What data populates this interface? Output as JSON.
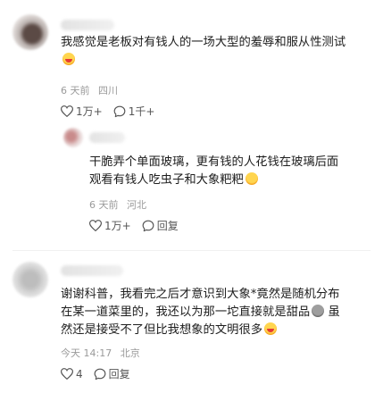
{
  "comments": [
    {
      "text": "我感觉是老板对有钱人的一场大型的羞辱和服从性测试",
      "time": "6 天前",
      "location": "四川",
      "likes": "1万+",
      "replies": "1千+"
    },
    {
      "text_line1": "干脆弄个单面玻璃，更有钱的人花钱在玻璃后面",
      "text_line2": "观看有钱人吃虫子和大象粑粑",
      "time": "6 天前",
      "location": "河北",
      "likes": "1万+",
      "reply_label": "回复"
    },
    {
      "text_line1": "谢谢科普，我看完之后才意识到大象*竟然是随机分布",
      "text_line2": "在某一道菜里的，我还以为那一坨直接就是甜品",
      "text_line2b": "虽",
      "text_line3": "然还是接受不了但比我想象的文明很多",
      "time": "今天 14:17",
      "location": "北京",
      "likes": "4",
      "reply_label": "回复"
    }
  ],
  "icons": {
    "like": "heart-outline-icon",
    "reply": "speech-bubble-icon",
    "emoji_cry": "crying-face-emoji",
    "emoji_sweat": "sweat-face-emoji"
  }
}
